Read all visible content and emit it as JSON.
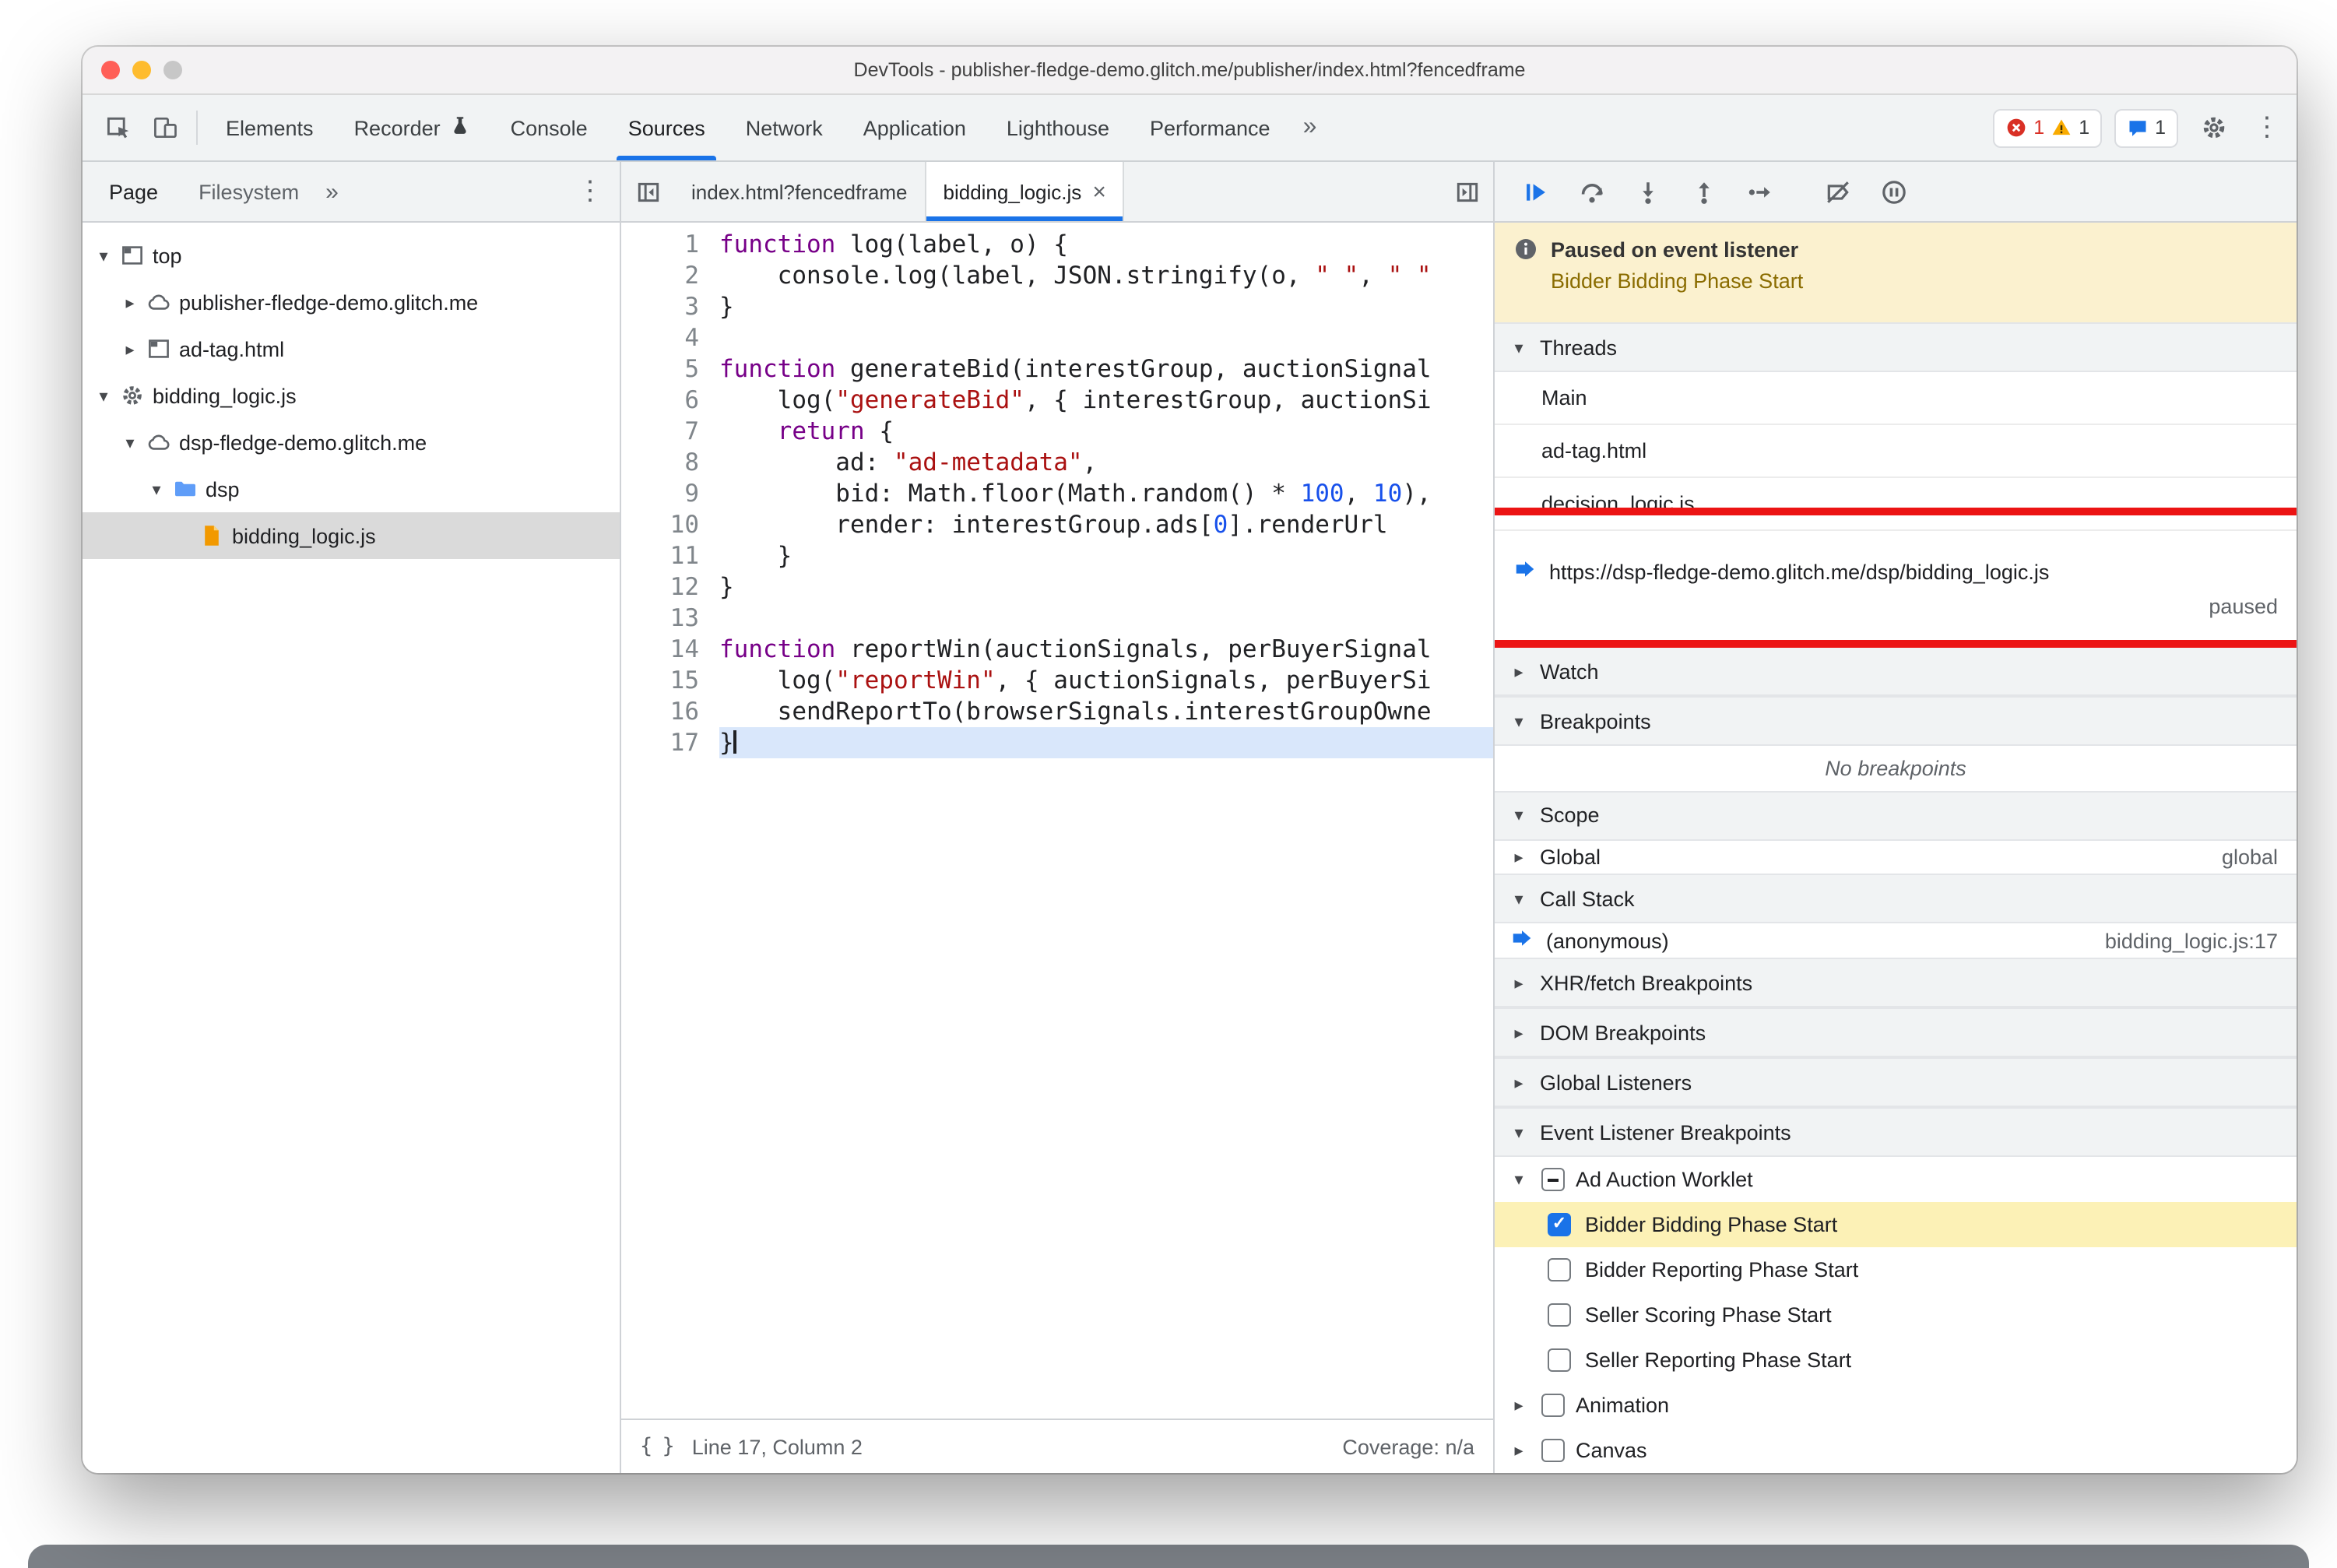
{
  "window": {
    "title": "DevTools - publisher-fledge-demo.glitch.me/publisher/index.html?fencedframe"
  },
  "glyphs": {
    "kebab": "⋮",
    "overflow": "»",
    "close": "×",
    "check": "✓",
    "tri_expanded": "▾",
    "tri_collapsed": "▸",
    "pretty_print": "{ }"
  },
  "colors": {
    "accent_blue": "#1a73e8",
    "error_red": "#d93025",
    "warning_yellow": "#f9ab00",
    "annotation_red": "#ec1414",
    "paused_banner_bg": "#fbf1cf",
    "paused_event_text": "#8a6c00",
    "checked_row_bg": "#fcf1b6",
    "execution_line_bg": "#d9e7fb",
    "keyword": "#770088",
    "string": "#aa1111",
    "number": "#1750eb"
  },
  "toolbar": {
    "tabs": [
      {
        "label": "Elements"
      },
      {
        "label": "Recorder",
        "badge": "beaker-icon"
      },
      {
        "label": "Console"
      },
      {
        "label": "Sources",
        "selected": true
      },
      {
        "label": "Network"
      },
      {
        "label": "Application"
      },
      {
        "label": "Lighthouse"
      },
      {
        "label": "Performance"
      }
    ],
    "error_count": "1",
    "warning_count": "1",
    "issues_count": "1"
  },
  "navigator": {
    "tabs": [
      {
        "label": "Page",
        "selected": true
      },
      {
        "label": "Filesystem",
        "selected": false
      }
    ],
    "tree": [
      {
        "label": "top",
        "icon": "frame-icon",
        "depth": 0,
        "state": "expanded"
      },
      {
        "label": "publisher-fledge-demo.glitch.me",
        "icon": "cloud-icon",
        "depth": 1,
        "state": "collapsed"
      },
      {
        "label": "ad-tag.html",
        "icon": "frame-icon",
        "depth": 1,
        "state": "collapsed"
      },
      {
        "label": "bidding_logic.js",
        "icon": "worker-gear-icon",
        "depth": 0,
        "state": "expanded"
      },
      {
        "label": "dsp-fledge-demo.glitch.me",
        "icon": "cloud-icon",
        "depth": 1,
        "state": "expanded"
      },
      {
        "label": "dsp",
        "icon": "folder-icon",
        "depth": 2,
        "state": "expanded"
      },
      {
        "label": "bidding_logic.js",
        "icon": "js-file-icon",
        "depth": 3,
        "state": "leaf",
        "selected": true
      }
    ]
  },
  "editor": {
    "tabs": [
      {
        "label": "index.html?fencedframe",
        "active": false
      },
      {
        "label": "bidding_logic.js",
        "active": true,
        "closable": true
      }
    ],
    "lines": [
      {
        "n": 1,
        "segs": [
          [
            "function",
            "kw"
          ],
          [
            " log(label, o) {",
            "d"
          ]
        ]
      },
      {
        "n": 2,
        "segs": [
          [
            "    console.log(label, JSON.stringify(o, ",
            "d"
          ],
          [
            "\" \"",
            "str"
          ],
          [
            ", ",
            "d"
          ],
          [
            "\" \"",
            "str"
          ]
        ]
      },
      {
        "n": 3,
        "segs": [
          [
            "}",
            "d"
          ]
        ]
      },
      {
        "n": 4,
        "segs": []
      },
      {
        "n": 5,
        "segs": [
          [
            "function",
            "kw"
          ],
          [
            " generateBid(interestGroup, auctionSignal",
            "d"
          ]
        ]
      },
      {
        "n": 6,
        "segs": [
          [
            "    log(",
            "d"
          ],
          [
            "\"generateBid\"",
            "str"
          ],
          [
            ", { interestGroup, auctionSi",
            "d"
          ]
        ]
      },
      {
        "n": 7,
        "segs": [
          [
            "    ",
            "d"
          ],
          [
            "return",
            "kw"
          ],
          [
            " {",
            "d"
          ]
        ]
      },
      {
        "n": 8,
        "segs": [
          [
            "        ad: ",
            "d"
          ],
          [
            "\"ad-metadata\"",
            "str"
          ],
          [
            ",",
            "d"
          ]
        ]
      },
      {
        "n": 9,
        "segs": [
          [
            "        bid: Math.floor(Math.random() * ",
            "d"
          ],
          [
            "100",
            "num"
          ],
          [
            ", ",
            "d"
          ],
          [
            "10",
            "num"
          ],
          [
            "),",
            "d"
          ]
        ]
      },
      {
        "n": 10,
        "segs": [
          [
            "        render: interestGroup.ads[",
            "d"
          ],
          [
            "0",
            "num"
          ],
          [
            "].renderUrl",
            "d"
          ]
        ]
      },
      {
        "n": 11,
        "segs": [
          [
            "    }",
            "d"
          ]
        ]
      },
      {
        "n": 12,
        "segs": [
          [
            "}",
            "d"
          ]
        ]
      },
      {
        "n": 13,
        "segs": []
      },
      {
        "n": 14,
        "segs": [
          [
            "function",
            "kw"
          ],
          [
            " reportWin(auctionSignals, perBuyerSignal",
            "d"
          ]
        ]
      },
      {
        "n": 15,
        "segs": [
          [
            "    log(",
            "d"
          ],
          [
            "\"reportWin\"",
            "str"
          ],
          [
            ", { auctionSignals, perBuyerSi",
            "d"
          ]
        ]
      },
      {
        "n": 16,
        "segs": [
          [
            "    sendReportTo(browserSignals.interestGroupOwne",
            "d"
          ]
        ]
      },
      {
        "n": 17,
        "segs": [
          [
            "}",
            "d"
          ]
        ],
        "execution_line": true,
        "cursor_after": true
      }
    ],
    "status": {
      "position": "Line 17, Column 2",
      "coverage": "Coverage: n/a"
    }
  },
  "debugger": {
    "banner": {
      "title": "Paused on event listener",
      "event": "Bidder Bidding Phase Start"
    },
    "threads": {
      "header": "Threads",
      "items": [
        {
          "label": "Main"
        },
        {
          "label": "ad-tag.html"
        },
        {
          "label": "decision_logic.js"
        },
        {
          "label": "https://dsp-fledge-demo.glitch.me/dsp/bidding_logic.js",
          "active": true,
          "status": "paused"
        }
      ]
    },
    "watch": {
      "header": "Watch",
      "collapsed": true
    },
    "breakpoints": {
      "header": "Breakpoints",
      "empty_message": "No breakpoints"
    },
    "scope": {
      "header": "Scope",
      "rows": [
        {
          "label": "Global",
          "value": "global"
        }
      ]
    },
    "call_stack": {
      "header": "Call Stack",
      "frames": [
        {
          "label": "(anonymous)",
          "location": "bidding_logic.js:17",
          "active": true
        }
      ]
    },
    "xhr_breakpoints": {
      "header": "XHR/fetch Breakpoints",
      "collapsed": true
    },
    "dom_breakpoints": {
      "header": "DOM Breakpoints",
      "collapsed": true
    },
    "global_listeners": {
      "header": "Global Listeners",
      "collapsed": true
    },
    "event_listener_breakpoints": {
      "header": "Event Listener Breakpoints",
      "categories": [
        {
          "label": "Ad Auction Worklet",
          "checkbox": "indeterminate",
          "expanded": true,
          "children": [
            {
              "label": "Bidder Bidding Phase Start",
              "checked": true,
              "highlighted": true
            },
            {
              "label": "Bidder Reporting Phase Start",
              "checked": false
            },
            {
              "label": "Seller Scoring Phase Start",
              "checked": false
            },
            {
              "label": "Seller Reporting Phase Start",
              "checked": false
            }
          ]
        },
        {
          "label": "Animation",
          "checkbox": "unchecked",
          "expanded": false,
          "children": []
        },
        {
          "label": "Canvas",
          "checkbox": "unchecked",
          "expanded": false,
          "children": []
        }
      ]
    }
  }
}
